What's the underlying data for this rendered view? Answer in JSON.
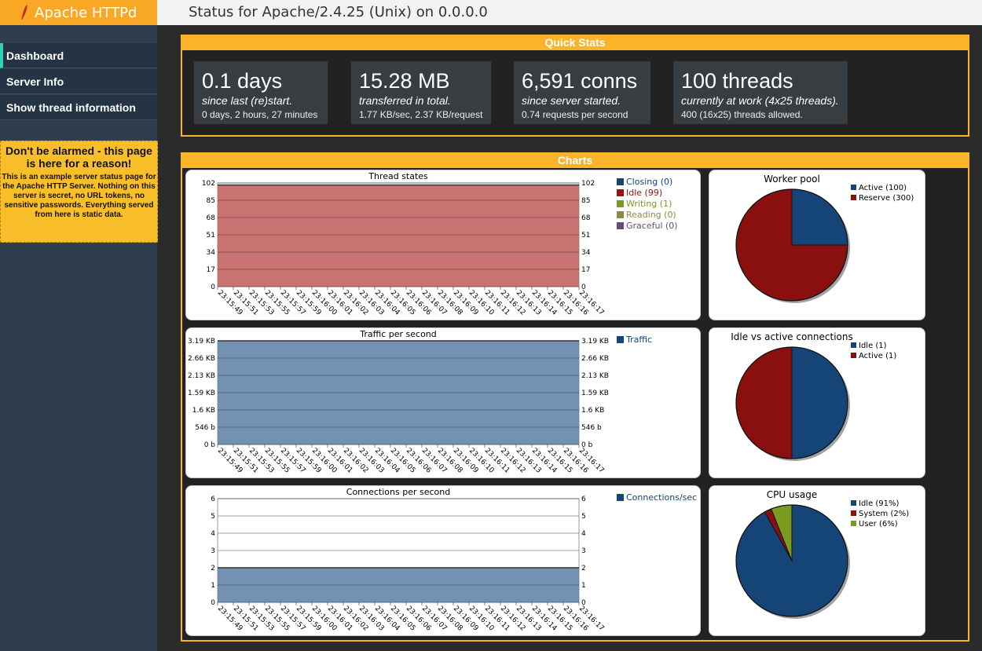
{
  "app": {
    "name": "Apache HTTPd"
  },
  "header": {
    "title": "Status for Apache/2.4.25 (Unix) on 0.0.0.0"
  },
  "sidebar": {
    "items": [
      {
        "label": "Dashboard",
        "active": true
      },
      {
        "label": "Server Info",
        "active": false
      },
      {
        "label": "Show thread information",
        "active": false
      }
    ],
    "notice_title": "Don't be alarmed - this page is here for a reason!",
    "notice_body": "This is an example server status page for the Apache HTTP Server. Nothing on this server is secret, no URL tokens, no sensitive passwords. Everything served from here is static data."
  },
  "quick_stats": {
    "title": "Quick Stats",
    "items": [
      {
        "big": "0.1 days",
        "sub": "since last (re)start.",
        "small": "0 days, 2 hours, 27 minutes"
      },
      {
        "big": "15.28 MB",
        "sub": "transferred in total.",
        "small": "1.77 KB/sec, 2.37 KB/request"
      },
      {
        "big": "6,591 conns",
        "sub": "since server started.",
        "small": "0.74 requests per second"
      },
      {
        "big": "100 threads",
        "sub": "currently at work (4x25 threads).",
        "small": "400 (16x25) threads allowed."
      }
    ]
  },
  "charts_title": "Charts",
  "colors": {
    "accent": "#f9b42a",
    "brand": "#f9a825",
    "nav_active": "#33d2b5"
  },
  "chart_data": [
    {
      "type": "area",
      "title": "Thread states",
      "x": [
        "23:15:49",
        "23:15:51",
        "23:15:53",
        "23:15:55",
        "23:15:57",
        "23:15:59",
        "23:16:00",
        "23:16:01",
        "23:16:02",
        "23:16:03",
        "23:16:04",
        "23:16:05",
        "23:16:06",
        "23:16:07",
        "23:16:08",
        "23:16:09",
        "23:16:10",
        "23:16:11",
        "23:16:12",
        "23:16:13",
        "23:16:14",
        "23:16:15",
        "23:16:16",
        "23:16:17"
      ],
      "yticks": [
        "0",
        "17",
        "34",
        "51",
        "68",
        "85",
        "102"
      ],
      "ylim": [
        0,
        102
      ],
      "series": [
        {
          "name": "Closing (0)",
          "color": "#154477",
          "value": 0
        },
        {
          "name": "Idle (99)",
          "color": "#a01010",
          "value": 99
        },
        {
          "name": "Writing (1)",
          "color": "#7a9a20",
          "value": 1
        },
        {
          "name": "Reading (0)",
          "color": "#8a8a40",
          "value": 0
        },
        {
          "name": "Graceful (0)",
          "color": "#6a4a7a",
          "value": 0
        }
      ]
    },
    {
      "type": "pie",
      "title": "Worker pool",
      "slices": [
        {
          "name": "Active (100)",
          "value": 100,
          "color": "#154477"
        },
        {
          "name": "Reserve (300)",
          "value": 300,
          "color": "#8a1010"
        }
      ]
    },
    {
      "type": "area",
      "title": "Traffic per second",
      "x": [
        "23:15:49",
        "23:15:51",
        "23:15:53",
        "23:15:55",
        "23:15:57",
        "23:15:59",
        "23:16:00",
        "23:16:01",
        "23:16:02",
        "23:16:03",
        "23:16:04",
        "23:16:05",
        "23:16:06",
        "23:16:07",
        "23:16:08",
        "23:16:09",
        "23:16:10",
        "23:16:11",
        "23:16:12",
        "23:16:13",
        "23:16:14",
        "23:16:15",
        "23:16:16",
        "23:16:17"
      ],
      "yticks": [
        "0 b",
        "546 b",
        "1.6 KB",
        "1.59 KB",
        "2.13 KB",
        "2.66 KB",
        "3.19 KB"
      ],
      "ylim": [
        0,
        6
      ],
      "series": [
        {
          "name": "Traffic",
          "color": "#154477",
          "value": 6
        }
      ]
    },
    {
      "type": "pie",
      "title": "Idle vs active connections",
      "slices": [
        {
          "name": "Idle (1)",
          "value": 1,
          "color": "#154477"
        },
        {
          "name": "Active (1)",
          "value": 1,
          "color": "#8a1010"
        }
      ]
    },
    {
      "type": "area",
      "title": "Connections per second",
      "x": [
        "23:15:49",
        "23:15:51",
        "23:15:53",
        "23:15:55",
        "23:15:57",
        "23:15:59",
        "23:16:00",
        "23:16:01",
        "23:16:02",
        "23:16:03",
        "23:16:04",
        "23:16:05",
        "23:16:06",
        "23:16:07",
        "23:16:08",
        "23:16:09",
        "23:16:10",
        "23:16:11",
        "23:16:12",
        "23:16:13",
        "23:16:14",
        "23:16:15",
        "23:16:16",
        "23:16:17"
      ],
      "yticks": [
        "0",
        "1",
        "2",
        "3",
        "4",
        "5",
        "6"
      ],
      "ylim": [
        0,
        6
      ],
      "series": [
        {
          "name": "Connections/sec",
          "color": "#154477",
          "value": 2
        }
      ]
    },
    {
      "type": "pie",
      "title": "CPU usage",
      "slices": [
        {
          "name": "Idle (91%)",
          "value": 91,
          "color": "#154477"
        },
        {
          "name": "System (2%)",
          "value": 2,
          "color": "#8a1010"
        },
        {
          "name": "User (6%)",
          "value": 6,
          "color": "#7a9a20"
        }
      ]
    }
  ]
}
